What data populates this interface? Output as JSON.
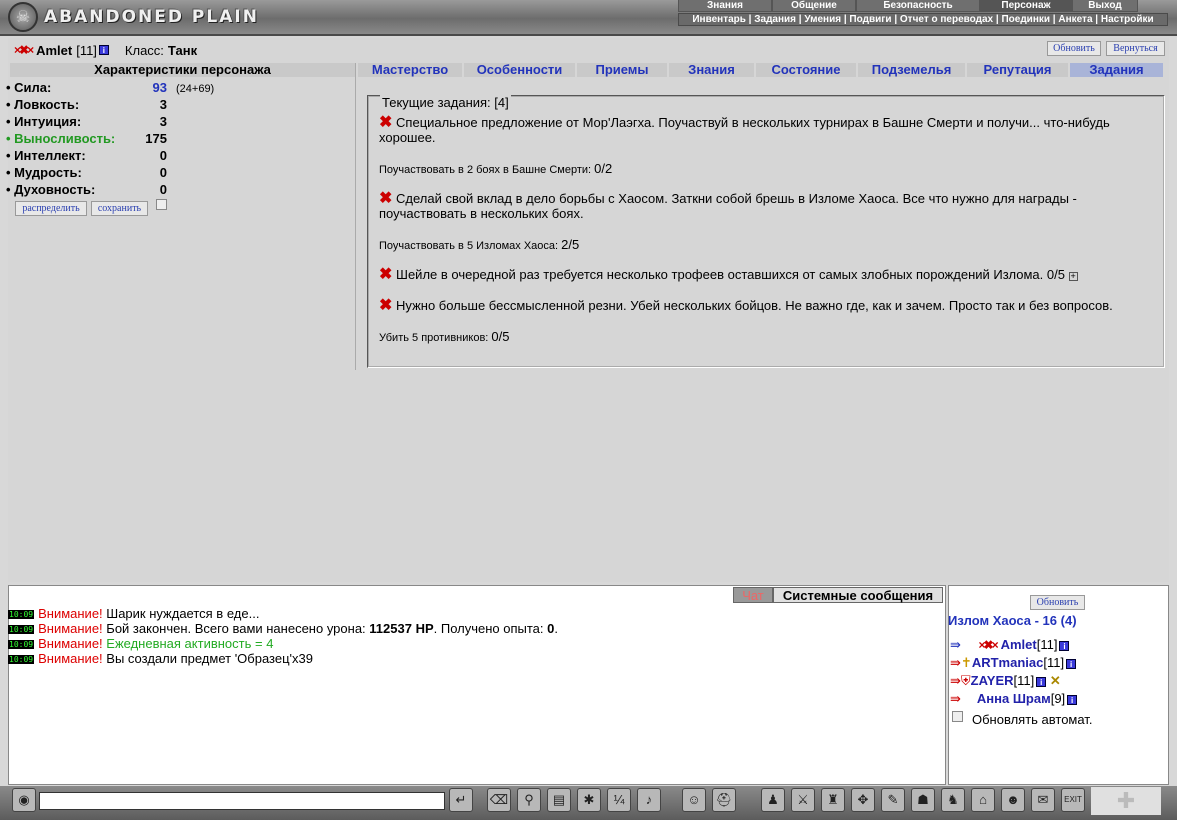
{
  "logo_text": "ABANDONED PLAIN",
  "top_menu": [
    "Знания",
    "Общение",
    "Безопасность",
    "Персонаж",
    "Выход"
  ],
  "sub_menu": "Инвентарь | Задания | Умения | Подвиги | Отчет о переводах | Поединки | Анкета | Настройки",
  "player": {
    "name": "Amlet",
    "level": "[11]",
    "class_label": "Класс:",
    "class_value": "Танк"
  },
  "buttons": {
    "refresh": "Обновить",
    "back": "Вернуться",
    "distribute": "распределить",
    "save": "сохранить",
    "refresh2": "Обновить"
  },
  "char_head": "Характеристики персонажа",
  "stats": [
    {
      "label": "• Сила:",
      "value": "93"
    },
    {
      "label": "• Ловкость:",
      "value": "3"
    },
    {
      "label": "• Интуиция:",
      "value": "3"
    },
    {
      "label": "• Выносливость:",
      "value": "175"
    },
    {
      "label": "• Интеллект:",
      "value": "0"
    },
    {
      "label": "• Мудрость:",
      "value": "0"
    },
    {
      "label": "• Духовность:",
      "value": "0"
    }
  ],
  "strength_bonus": "(24+69)",
  "tabs": [
    "Мастерство",
    "Особенности",
    "Приемы",
    "Знания",
    "Состояние",
    "Подземелья",
    "Репутация",
    "Задания"
  ],
  "quests_legend": "Текущие задания: [4]",
  "quests": [
    {
      "text": "Специальное предложение от Мор'Лаэгха. Поучаствуй в нескольких турнирах в Башне Смерти и получи... что-нибудь хорошее.",
      "sub": "Поучаствовать в 2 боях в Башне Смерти:",
      "progress": "0/2"
    },
    {
      "text": "Сделай свой вклад в дело борьбы с Хаосом. Заткни собой брешь в Изломе Хаоса. Все что нужно для награды - поучаствовать в нескольких боях.",
      "sub": "Поучаствовать в 5 Изломах Хаоса:",
      "progress": "2/5"
    },
    {
      "text": "Шейле в очередной раз требуется несколько трофеев оставшихся от самых злобных порождений Излома. 0/5",
      "sub": "",
      "progress": ""
    },
    {
      "text": "Нужно больше бессмысленной резни. Убей нескольких бойцов. Не важно где, как и зачем. Просто так и без вопросов.",
      "sub": "Убить 5 противников:",
      "progress": "0/5"
    }
  ],
  "chat_tabs": {
    "chat": "Чат",
    "system": "Системные сообщения"
  },
  "chat_lines": [
    {
      "time": "10:09",
      "warn": "Внимание!",
      "text": "Шарик нуждается в еде..."
    },
    {
      "time": "10:09",
      "warn": "Внимание!",
      "text_pre": "Бой закончен. Всего вами нанесено урона:",
      "bold1": "112537 HP",
      "text_mid": ". Получено опыта:",
      "bold2": "0",
      "text_end": "."
    },
    {
      "time": "10:09",
      "warn": "Внимание!",
      "green": "Ежедневная активность = 4"
    },
    {
      "time": "10:09",
      "warn": "Внимание!",
      "text": "Вы создали предмет 'Образец'x39"
    }
  ],
  "location": "Излом Хаоса - 16 (4)",
  "players": [
    {
      "name": "Amlet",
      "level": "[11]"
    },
    {
      "name": "ARTmaniac",
      "level": "[11]"
    },
    {
      "name": "ZAYER",
      "level": "[11]"
    },
    {
      "name": "Анна Шрам",
      "level": "[9]"
    }
  ],
  "auto_refresh": "Обновлять автомат.",
  "colors": {
    "link": "#2233bb",
    "warn": "#dd0000",
    "green": "#22aa22",
    "stat_hi": "#229922"
  }
}
